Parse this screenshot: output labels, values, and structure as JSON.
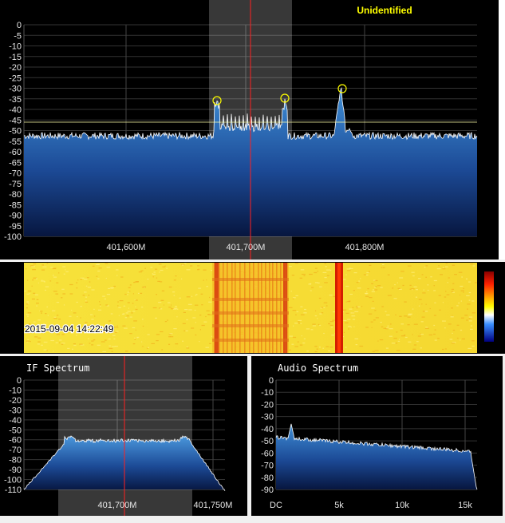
{
  "main_spectrum": {
    "signal_label": "Unidentified",
    "y_ticks": [
      "0",
      "-5",
      "-10",
      "-15",
      "-20",
      "-25",
      "-30",
      "-35",
      "-40",
      "-45",
      "-50",
      "-55",
      "-60",
      "-65",
      "-70",
      "-75",
      "-80",
      "-85",
      "-90",
      "-95",
      "-100"
    ],
    "x_ticks": [
      "401,600M",
      "401,700M",
      "401,800M"
    ]
  },
  "waterfall": {
    "timestamp": "2015-09-04 14:22:49"
  },
  "if_spectrum": {
    "title": "IF Spectrum",
    "y_ticks": [
      "0",
      "-10",
      "-20",
      "-30",
      "-40",
      "-50",
      "-60",
      "-70",
      "-80",
      "-90",
      "-100",
      "-110"
    ],
    "x_ticks": [
      "401,700M",
      "401,750M"
    ]
  },
  "audio_spectrum": {
    "title": "Audio Spectrum",
    "y_ticks": [
      "0",
      "-10",
      "-20",
      "-30",
      "-40",
      "-50",
      "-60",
      "-70",
      "-80",
      "-90"
    ],
    "x_ticks": [
      "DC",
      "5k",
      "10k",
      "15k"
    ]
  },
  "colors": {
    "background": "#000000",
    "grid": "#3a3a3a",
    "trace": "#ffffff",
    "fill_top": "#3a86d0",
    "fill_bottom": "#0a1a50",
    "tuning_line": "#ff2020",
    "peak_marker": "#ffff00",
    "label_yellow": "#ffff00"
  }
}
